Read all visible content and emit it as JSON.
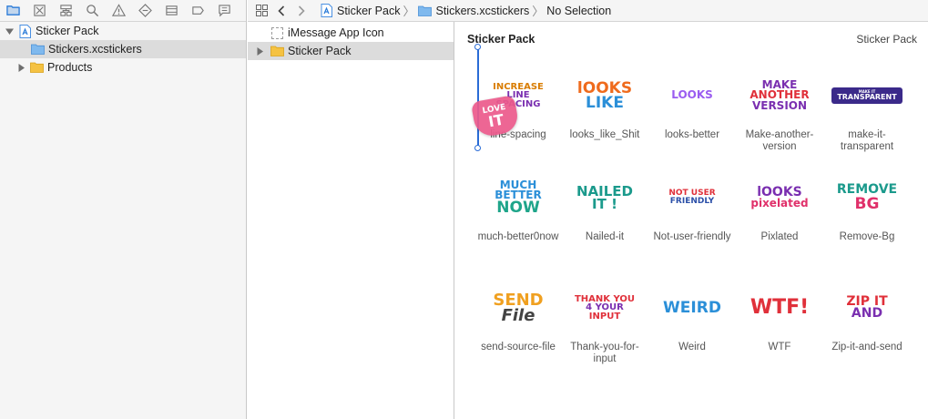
{
  "navigator": {
    "project_name": "Sticker Pack",
    "files": [
      {
        "label": "Stickers.xcstickers"
      },
      {
        "label": "Products"
      }
    ]
  },
  "jumpbar": {
    "crumbs": [
      "Sticker Pack",
      "Stickers.xcstickers",
      "No Selection"
    ]
  },
  "asset_list": {
    "items": [
      {
        "label": "iMessage App Icon"
      },
      {
        "label": "Sticker Pack"
      }
    ]
  },
  "editor": {
    "title": "Sticker Pack",
    "right_title": "Sticker Pack",
    "stickers": [
      {
        "label": "line-spacing",
        "art": [
          "INCREASE",
          "LINE",
          "SPACING"
        ]
      },
      {
        "label": "looks_like_Shit",
        "art": [
          "lOOKS",
          "LIKE"
        ]
      },
      {
        "label": "looks-better",
        "art": [
          "LOOKS"
        ]
      },
      {
        "label": "Make-another-version",
        "art": [
          "MAKE",
          "ANOTHER",
          "VERSION"
        ]
      },
      {
        "label": "make-it-transparent",
        "art": [
          "MAKE IT",
          "TRANSPARENT"
        ]
      },
      {
        "label": "much-better0now",
        "art": [
          "MUCH",
          "BETTER",
          "NOW"
        ]
      },
      {
        "label": "Nailed-it",
        "art": [
          "NAILED",
          "IT !"
        ]
      },
      {
        "label": "Not-user-friendly",
        "art": [
          "NOT USER",
          "FRIENDLY"
        ]
      },
      {
        "label": "Pixlated",
        "art": [
          "lOOKS",
          "pixelated"
        ]
      },
      {
        "label": "Remove-Bg",
        "art": [
          "REMOVE",
          "BG"
        ]
      },
      {
        "label": "send-source-file",
        "art": [
          "SEND",
          "File"
        ]
      },
      {
        "label": "Thank-you-for-input",
        "art": [
          "THANK YOU",
          "4 YOUR",
          "INPUT"
        ]
      },
      {
        "label": "Weird",
        "art": [
          "WEIRD"
        ]
      },
      {
        "label": "WTF",
        "art": [
          "WTF!"
        ]
      },
      {
        "label": "Zip-it-and-send",
        "art": [
          "ZIP IT",
          "AND"
        ]
      }
    ],
    "drag_overlay": {
      "art": [
        "LOVE",
        "IT"
      ]
    }
  },
  "colors": {
    "selection_bg": "#dcdcdc",
    "folder_yellow": "#f5c242",
    "accent_blue": "#2a7bd8"
  }
}
